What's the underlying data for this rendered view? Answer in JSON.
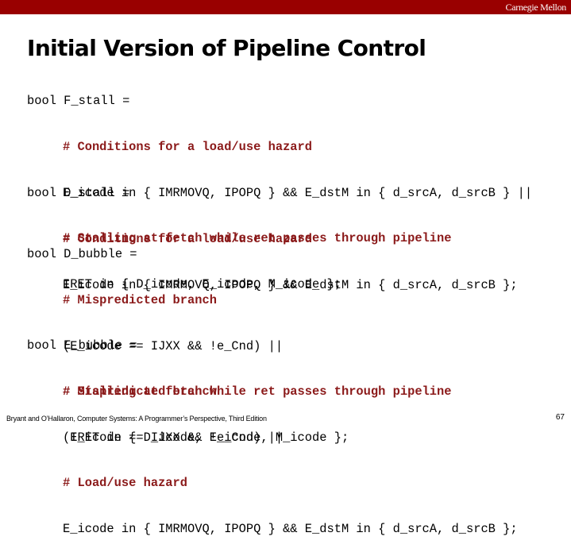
{
  "header": {
    "brand": "Carnegie Mellon",
    "bar_color": "#990000"
  },
  "title": "Initial Version of Pipeline Control",
  "blocks": [
    {
      "decl": "bool F_stall =",
      "lines": [
        {
          "type": "comment",
          "text": "# Conditions for a load/use hazard"
        },
        {
          "type": "code",
          "text": "E_icode in { IMRMOVQ, IPOPQ } && E_dstM in { d_srcA, d_srcB } ||"
        },
        {
          "type": "comment",
          "text": "# Stalling at fetch while ret passes through pipeline"
        },
        {
          "type": "code",
          "text": "IRET in { D_icode, E_icode, M_icode };"
        }
      ]
    },
    {
      "decl": "bool D_stall =",
      "lines": [
        {
          "type": "comment",
          "text": "# Conditions for a load/use hazard"
        },
        {
          "type": "code",
          "text": "E_icode in { IMRMOVQ, IPOPQ } && E_dstM in { d_srcA, d_srcB };"
        }
      ]
    },
    {
      "decl": "bool D_bubble =",
      "lines": [
        {
          "type": "comment",
          "text": "# Mispredicted branch"
        },
        {
          "type": "code",
          "text": "(E_icode == IJXX && !e_Cnd) ||"
        },
        {
          "type": "comment",
          "text": "# Stalling at fetch while ret passes through pipeline"
        },
        {
          "type": "code",
          "text": " IRET in { D_icode, E_icode, M_icode };"
        }
      ]
    },
    {
      "decl": "bool E_bubble =",
      "lines": [
        {
          "type": "comment",
          "text": "# Mispredicted branch"
        },
        {
          "type": "code",
          "text": "(E_icode == IJXX && !e_Cnd) ||"
        },
        {
          "type": "comment",
          "text": "# Load/use hazard"
        },
        {
          "type": "code",
          "text": "E_icode in { IMRMOVQ, IPOPQ } && E_dstM in { d_srcA, d_srcB };"
        }
      ]
    }
  ],
  "colors": {
    "comment": "#8b1a1a",
    "code": "#000000"
  },
  "footer": {
    "citation": "Bryant and O’Hallaron, Computer Systems: A Programmer’s Perspective, Third Edition",
    "page_number": "67"
  }
}
